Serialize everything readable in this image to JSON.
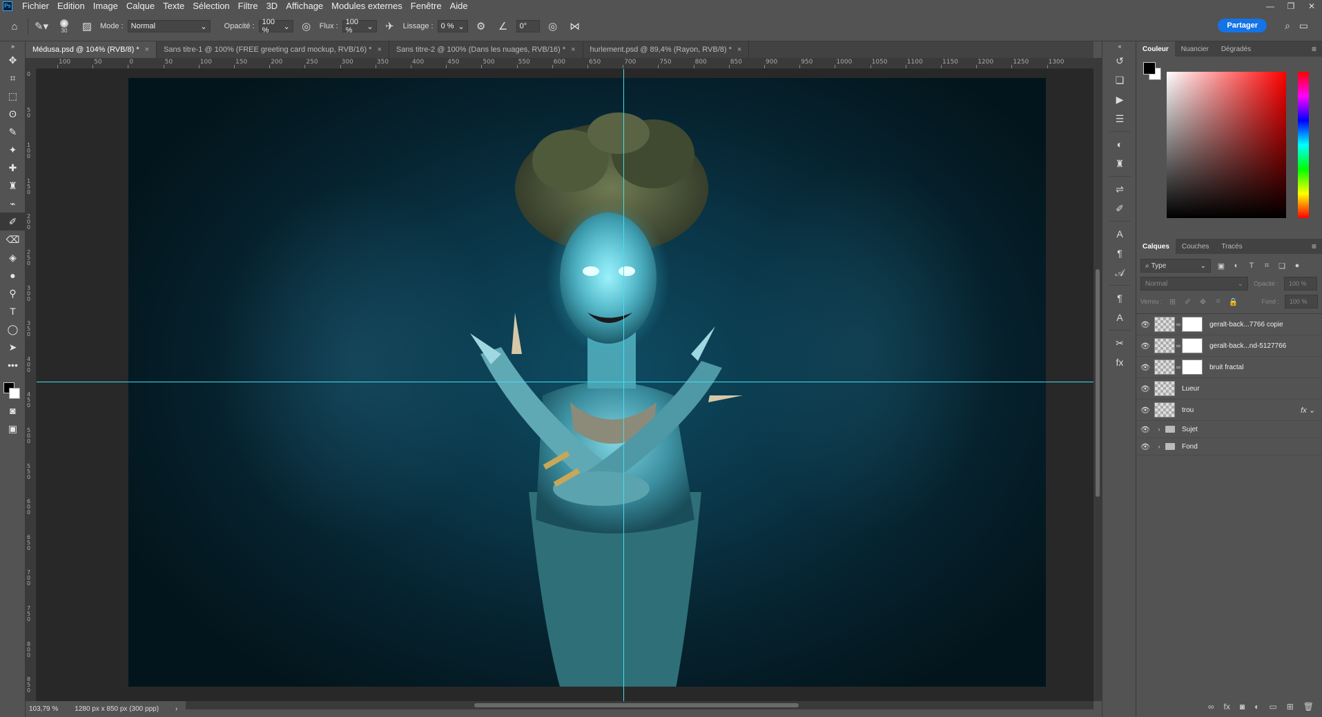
{
  "menu": {
    "app_icon": "Ps",
    "items": [
      "Fichier",
      "Edition",
      "Image",
      "Calque",
      "Texte",
      "Sélection",
      "Filtre",
      "3D",
      "Affichage",
      "Modules externes",
      "Fenêtre",
      "Aide"
    ]
  },
  "options": {
    "brush_size": "30",
    "mode_label": "Mode :",
    "mode_value": "Normal",
    "opacity_label": "Opacité :",
    "opacity_value": "100 %",
    "flux_label": "Flux :",
    "flux_value": "100 %",
    "lissage_label": "Lissage :",
    "lissage_value": "0 %",
    "angle_value": "0°",
    "share_label": "Partager"
  },
  "tabs": [
    {
      "label": "Médusa.psd @ 104% (RVB/8) *",
      "active": true
    },
    {
      "label": "Sans titre-1 @ 100% (FREE greeting card mockup, RVB/16) *",
      "active": false
    },
    {
      "label": "Sans titre-2 @ 100% (Dans les nuages, RVB/16) *",
      "active": false
    },
    {
      "label": "hurlement.psd @ 89,4% (Rayon, RVB/8) *",
      "active": false
    }
  ],
  "ruler": {
    "h_labels": [
      "100",
      "50",
      "0",
      "50",
      "100",
      "150",
      "200",
      "250",
      "300",
      "350",
      "400",
      "450",
      "500",
      "550",
      "600",
      "650",
      "700",
      "750",
      "800",
      "850",
      "900",
      "950",
      "1000",
      "1050",
      "1100",
      "1150",
      "1200",
      "1250",
      "1300"
    ],
    "v_labels": [
      "0",
      "5 0",
      "1 0 0",
      "1 5 0",
      "2 0 0",
      "2 5 0",
      "3 0 0",
      "3 5 0",
      "4 0 0",
      "4 5 0",
      "5 0 0",
      "5 5 0",
      "6 0 0",
      "6 5 0",
      "7 0 0",
      "7 5 0",
      "8 0 0",
      "8 5 0"
    ]
  },
  "status": {
    "zoom": "103,79 %",
    "doc_size": "1280 px x 850 px (300 ppp)"
  },
  "color_panel": {
    "tabs": [
      "Couleur",
      "Nuancier",
      "Dégradés"
    ],
    "foreground": "#000000",
    "background": "#ffffff"
  },
  "layers_panel": {
    "tabs": [
      "Calques",
      "Couches",
      "Tracés"
    ],
    "filter_type": "Type",
    "blend_mode": "Normal",
    "opacity_label": "Opacité :",
    "opacity_value": "100 %",
    "lock_label": "Verrou :",
    "fill_label": "Fond :",
    "fill_value": "100 %",
    "layers": [
      {
        "name": "geralt-back...7766 copie",
        "kind": "smart-mask"
      },
      {
        "name": "geralt-back...nd-5127766",
        "kind": "smart-mask"
      },
      {
        "name": "bruit fractal",
        "kind": "mask"
      },
      {
        "name": "Lueur",
        "kind": "plain"
      },
      {
        "name": "trou",
        "kind": "fx"
      },
      {
        "name": "Sujet",
        "kind": "group"
      },
      {
        "name": "Fond",
        "kind": "group"
      }
    ]
  },
  "colors": {
    "accent": "#1473e6",
    "guide": "#40e0f0"
  }
}
